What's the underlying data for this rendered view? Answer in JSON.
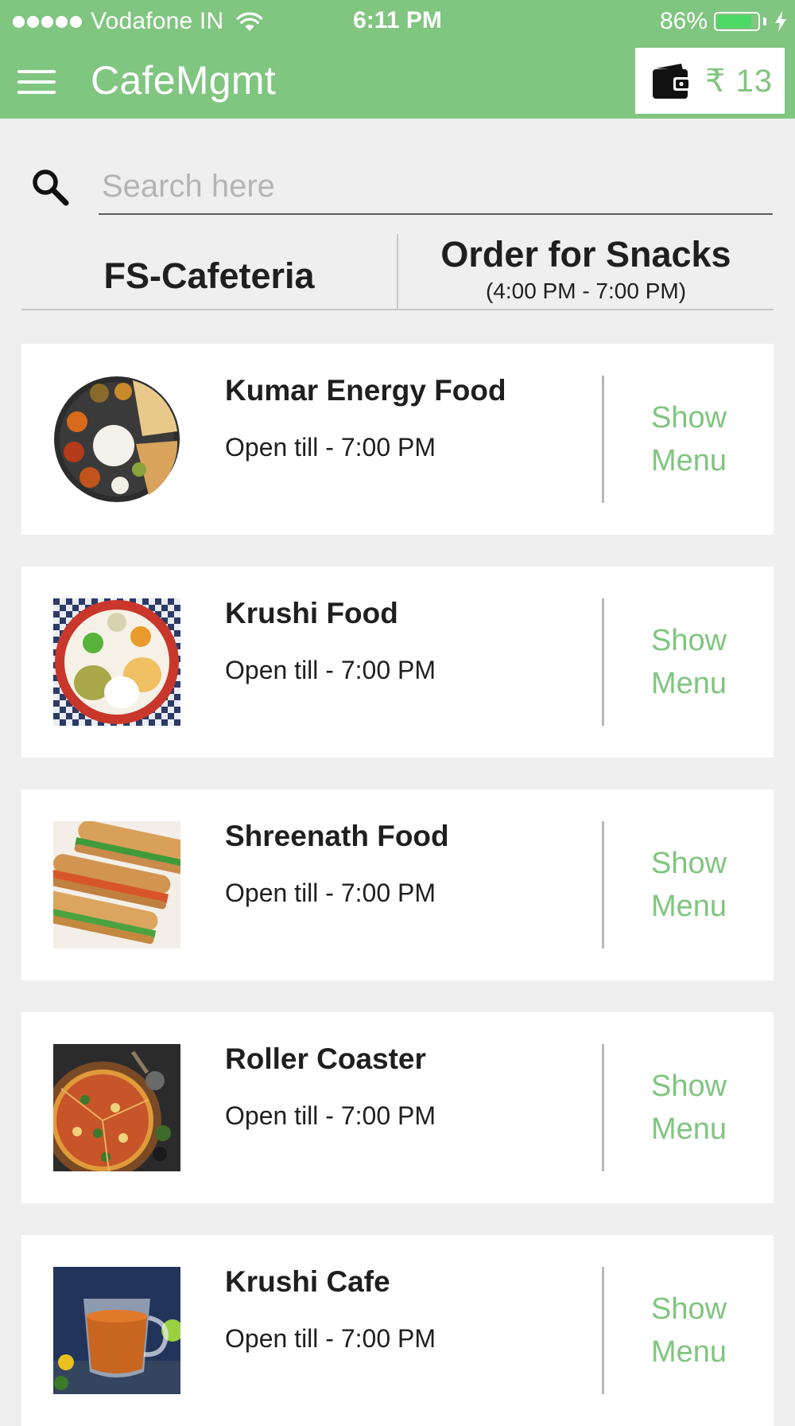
{
  "status_bar": {
    "carrier": "Vodafone IN",
    "time": "6:11 PM",
    "battery": "86%",
    "battery_level": 0.86
  },
  "app_bar": {
    "title": "CafeMgmt",
    "wallet": {
      "currency": "₹",
      "amount": "13"
    }
  },
  "search": {
    "value": "",
    "placeholder": "Search here"
  },
  "header": {
    "cafeteria": "FS-Cafeteria",
    "order_title": "Order for Snacks",
    "order_time": "(4:00 PM - 7:00 PM)"
  },
  "vendors": [
    {
      "name": "Kumar Energy Food",
      "hours": "Open till - 7:00 PM",
      "menu_line1": "Show",
      "menu_line2": "Menu",
      "thumb": "thali-plate-icon"
    },
    {
      "name": "Krushi Food",
      "hours": "Open till - 7:00 PM",
      "menu_line1": "Show",
      "menu_line2": "Menu",
      "thumb": "idli-plate-icon"
    },
    {
      "name": "Shreenath Food",
      "hours": "Open till - 7:00 PM",
      "menu_line1": "Show",
      "menu_line2": "Menu",
      "thumb": "sandwich-icon"
    },
    {
      "name": "Roller Coaster",
      "hours": "Open till - 7:00 PM",
      "menu_line1": "Show",
      "menu_line2": "Menu",
      "thumb": "pizza-icon"
    },
    {
      "name": "Krushi Cafe",
      "hours": "Open till - 7:00 PM",
      "menu_line1": "Show",
      "menu_line2": "Menu",
      "thumb": "tea-cup-icon"
    }
  ],
  "colors": {
    "primary": "#80c580",
    "background": "#efefef",
    "card": "#ffffff",
    "battery_fill": "#4cd964"
  }
}
